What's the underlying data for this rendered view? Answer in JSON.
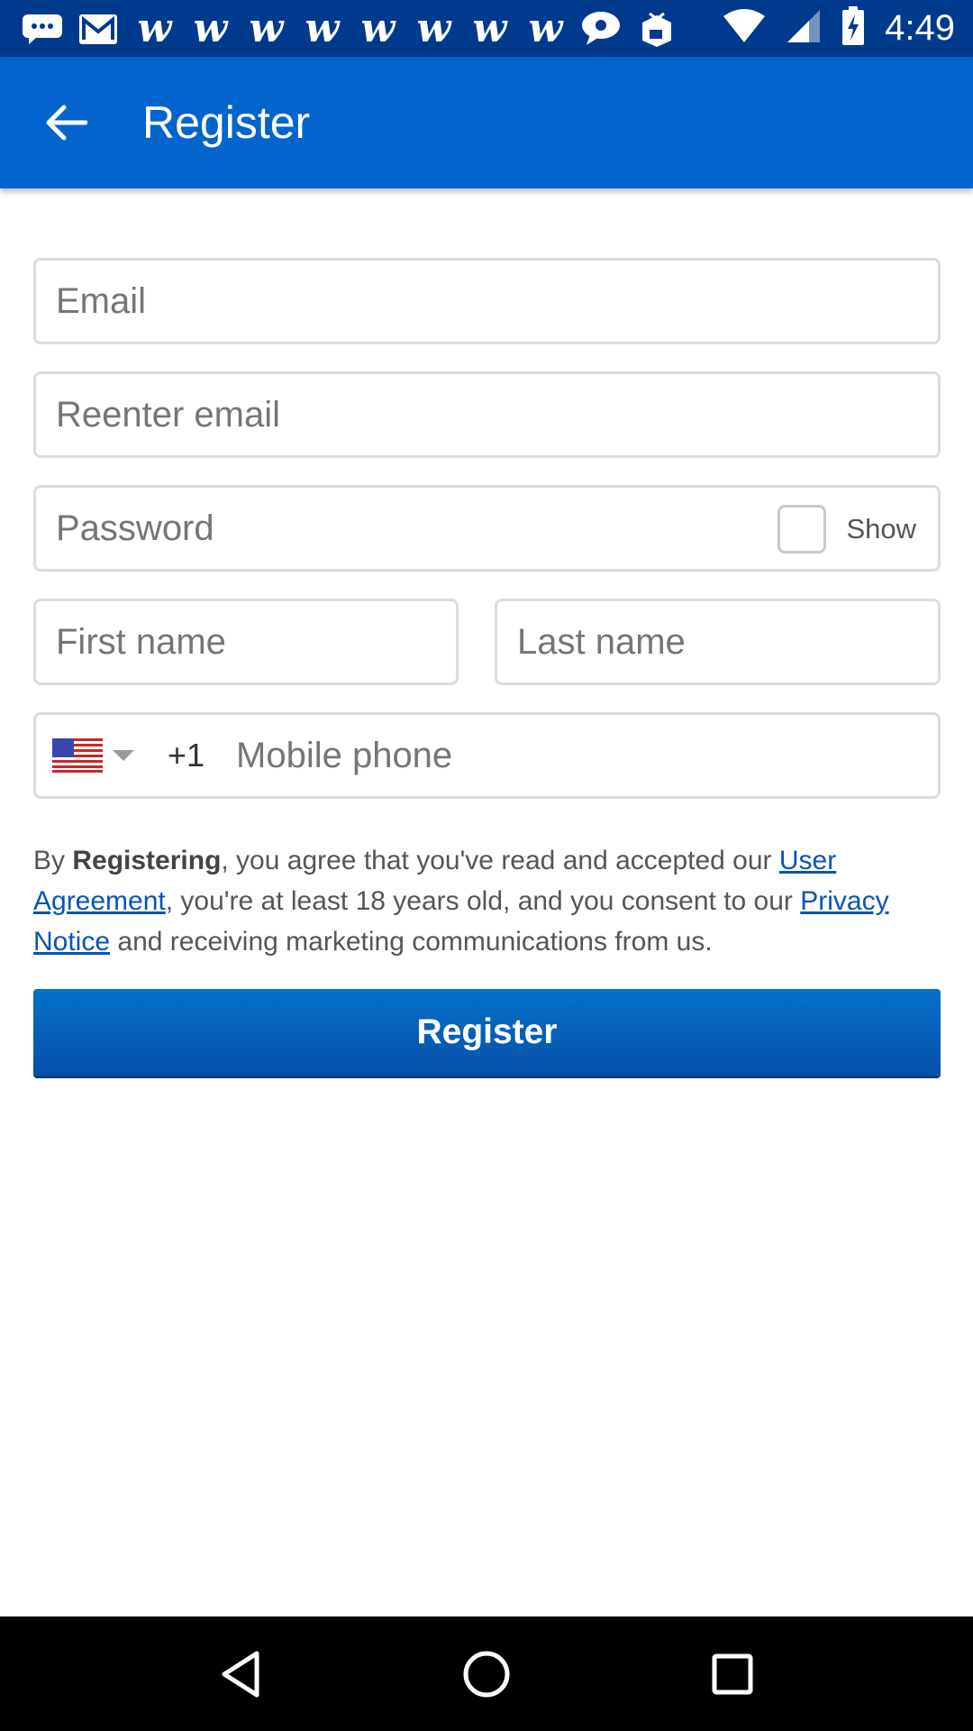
{
  "status_bar": {
    "time": "4:49",
    "notification_icons": [
      "message-icon",
      "gmail-icon",
      "w-app-icon",
      "w-app-icon",
      "w-app-icon",
      "w-app-icon",
      "w-app-icon",
      "w-app-icon",
      "w-app-icon",
      "w-app-icon",
      "chat-bubble-icon",
      "box-app-icon"
    ],
    "w_glyph": "w"
  },
  "app_bar": {
    "title": "Register",
    "color": "#0264cc"
  },
  "form": {
    "email_placeholder": "Email",
    "reenter_email_placeholder": "Reenter email",
    "password_placeholder": "Password",
    "show_label": "Show",
    "first_name_placeholder": "First name",
    "last_name_placeholder": "Last name",
    "country_code": "+1",
    "mobile_placeholder": "Mobile phone",
    "country_flag": "us-flag-icon"
  },
  "legal": {
    "prefix": "By ",
    "bold": "Registering",
    "text1": ", you agree that you've read and accepted our ",
    "link1": "User Agreement",
    "text2": ", you're at least 18 years old, and you consent to our ",
    "link2": "Privacy Notice",
    "text3": " and receiving marketing communications from us."
  },
  "register_button": {
    "label": "Register",
    "color": "#0660b8"
  },
  "nav_bar": {
    "buttons": [
      "back-triangle-icon",
      "home-circle-icon",
      "recents-square-icon"
    ]
  }
}
